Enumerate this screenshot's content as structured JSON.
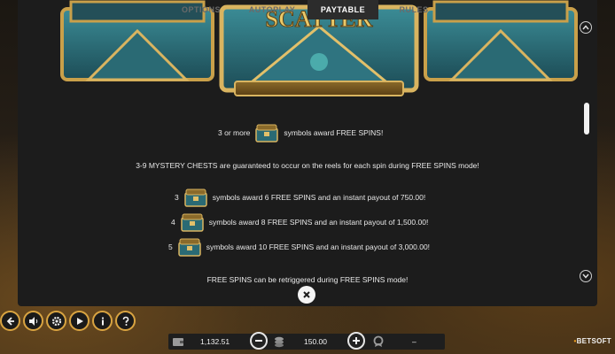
{
  "tabs": [
    {
      "label": "OPTIONS",
      "active": false
    },
    {
      "label": "AUTOPLAY",
      "active": false
    },
    {
      "label": "PAYTABLE",
      "active": true
    },
    {
      "label": "RULES",
      "active": false
    }
  ],
  "banner": {
    "title": "SCATTER"
  },
  "paytable": {
    "line1_prefix": "3 or more",
    "line1_suffix": "symbols award FREE SPINS!",
    "line2": "3-9 MYSTERY CHESTS are guaranteed to occur on the reels for each spin during FREE SPINS mode!",
    "rows": [
      {
        "count": "3",
        "text": "symbols award 6 FREE SPINS and an instant payout of 750.00!"
      },
      {
        "count": "4",
        "text": "symbols award 8 FREE SPINS and an instant payout of 1,500.00!"
      },
      {
        "count": "5",
        "text": "symbols award 10 FREE SPINS and an instant payout of 3,000.00!"
      }
    ],
    "line3": "FREE SPINS can be retriggered during FREE SPINS mode!"
  },
  "controls": [
    {
      "name": "back-icon"
    },
    {
      "name": "sound-icon"
    },
    {
      "name": "settings-icon"
    },
    {
      "name": "turbo-icon"
    },
    {
      "name": "info-icon"
    },
    {
      "name": "help-icon"
    }
  ],
  "bottom_bar": {
    "balance": "1,132.51",
    "bet": "150.00",
    "win": "–"
  },
  "logo": {
    "text": "BETSOFT"
  },
  "colors": {
    "accent": "#d9a441",
    "panel": "#1c1c1c",
    "teal": "#2b6b78"
  }
}
